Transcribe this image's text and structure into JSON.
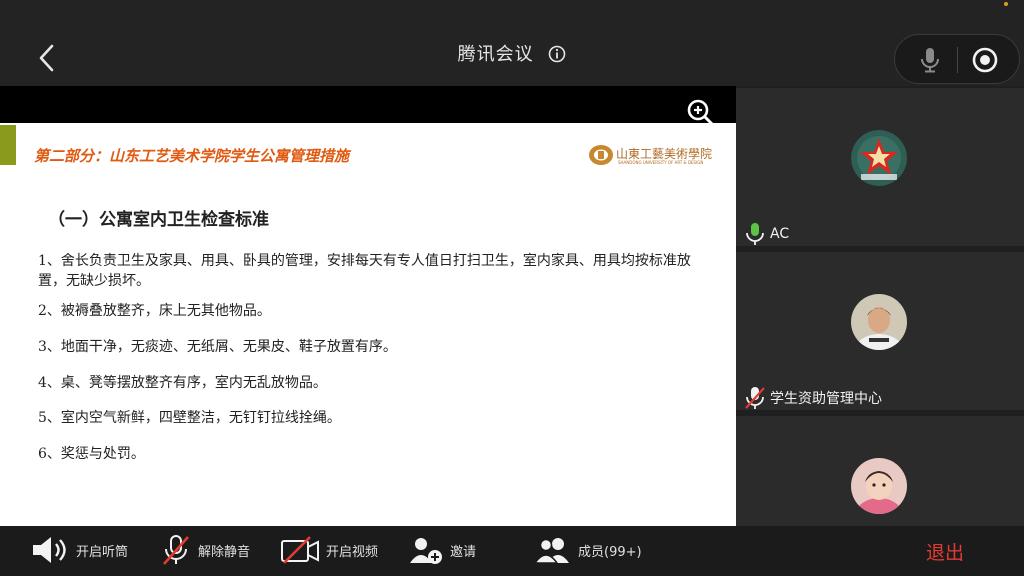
{
  "header": {
    "title": "腾讯会议",
    "info_icon": "info-icon",
    "back_icon": "chevron-left-icon",
    "mic_icon": "microphone-icon",
    "record_icon": "record-icon"
  },
  "slide": {
    "header": "第二部分：山东工艺美术学院学生公寓管理措施",
    "logo_cn": "山東工藝美術學院",
    "logo_en": "SHANDONG UNIVERSITY OF ART & DESIGN",
    "heading": "（一）公寓室内卫生检查标准",
    "items": [
      "1、舍长负责卫生及家具、用具、卧具的管理，安排每天有专人值日打扫卫生，室内家具、用具均按标准放置，无缺少损坏。",
      "2、被褥叠放整齐，床上无其他物品。",
      "3、地面干净，无痰迹、无纸屑、无果皮、鞋子放置有序。",
      "4、桌、凳等摆放整齐有序，室内无乱放物品。",
      "5、室内空气新鲜，四壁整洁，无钉钉拉线拴绳。",
      "6、奖惩与处罚。"
    ]
  },
  "participants": [
    {
      "name": "AC",
      "mic": "mic-on",
      "avatar": "red-star-badge-avatar"
    },
    {
      "name": "学生资助管理中心",
      "mic": "mic-muted",
      "avatar": "person-photo-avatar"
    },
    {
      "name": "",
      "mic": "",
      "avatar": "child-photo-avatar"
    }
  ],
  "toolbar": {
    "speaker_label": "开启听筒",
    "unmute_label": "解除静音",
    "video_label": "开启视频",
    "invite_label": "邀请",
    "members_label": "成员(99+)",
    "exit_label": "退出"
  },
  "colors": {
    "accent_exit": "#e23b32",
    "mic_on": "#5cc24a",
    "mute_red": "#e23b32",
    "slide_header": "#e05a12"
  }
}
